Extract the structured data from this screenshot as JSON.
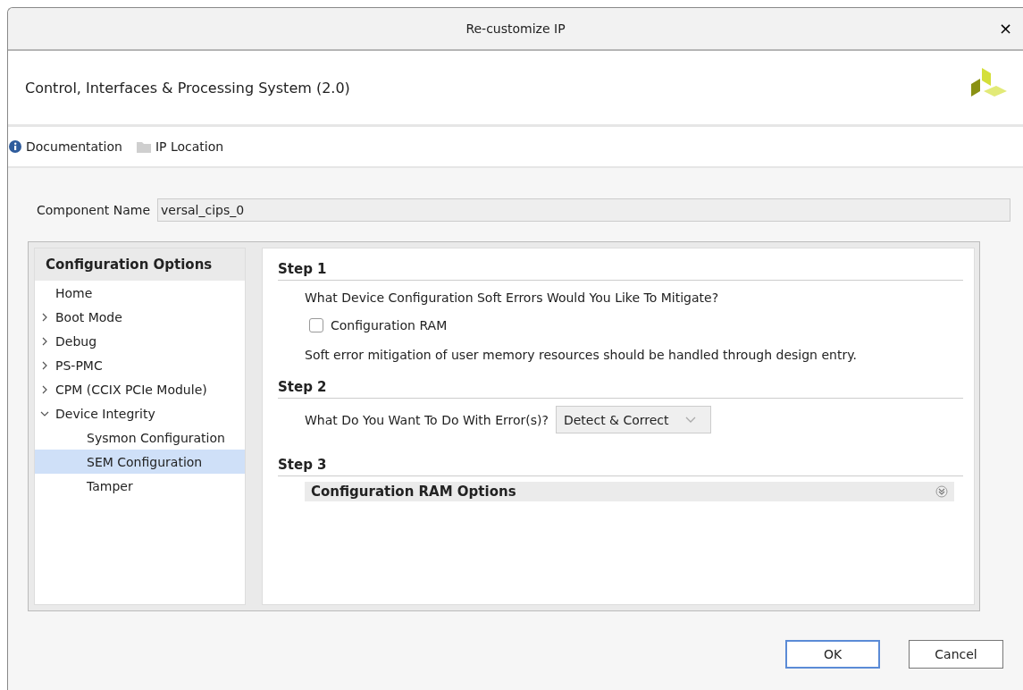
{
  "window": {
    "title": "Re-customize IP",
    "close": "×"
  },
  "header": {
    "title": "Control, Interfaces & Processing System (2.0)"
  },
  "toolbar": [
    "Documentation",
    "IP Location"
  ],
  "component_name": {
    "label": "Component Name",
    "value": "versal_cips_0"
  },
  "sidebar": {
    "title": "Configuration Options",
    "items": [
      {
        "label": "Home",
        "selected": false
      },
      {
        "label": "Boot Mode",
        "expanded": false,
        "selected": false
      },
      {
        "label": "Debug",
        "expanded": false,
        "selected": false
      },
      {
        "label": "PS-PMC",
        "expanded": false,
        "selected": false
      },
      {
        "label": "CPM (CCIX PCIe Module)",
        "expanded": false,
        "selected": false
      },
      {
        "label": "Device Integrity",
        "expanded": true,
        "selected": false,
        "children": [
          {
            "label": "Sysmon Configuration",
            "selected": false
          },
          {
            "label": "SEM Configuration",
            "selected": true
          },
          {
            "label": "Tamper",
            "selected": false
          }
        ]
      }
    ]
  },
  "steps": [
    {
      "title": "Step 1",
      "question": "What Device Configuration Soft Errors Would You Like To Mitigate?",
      "checkbox": {
        "label": "Configuration RAM",
        "checked": false
      },
      "note": "Soft error mitigation of user memory resources should be handled through design entry."
    },
    {
      "title": "Step 2",
      "question": "What Do You Want To Do With Error(s)?",
      "select": {
        "value": "Detect & Correct"
      }
    },
    {
      "title": "Step 3",
      "section": {
        "title": "Configuration RAM Options",
        "expanded": false
      }
    }
  ],
  "buttons": [
    {
      "label": "OK",
      "default": true
    },
    {
      "label": "Cancel",
      "default": false
    }
  ]
}
